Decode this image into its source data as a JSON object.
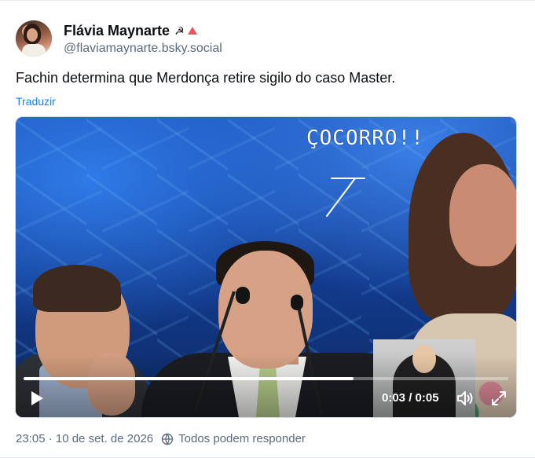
{
  "author": {
    "display_name": "Flávia Maynarte",
    "badges": [
      "☭",
      "triangle-emoji"
    ],
    "handle": "@flaviamaynarte.bsky.social"
  },
  "post": {
    "text": "Fachin determina que Merdonça retire sigilo do caso Master.",
    "translate_label": "Traduzir"
  },
  "video": {
    "overlay_text": "ÇOCORRO!!",
    "time_label": "0:03 / 0:05",
    "progress": 0.68
  },
  "footer": {
    "timestamp": "23:05 · 10 de set. de 2026",
    "reply_setting": "Todos podem responder"
  },
  "colors": {
    "link": "#1083fe",
    "muted": "#5b6b7b",
    "badge_red": "#e8535e"
  }
}
